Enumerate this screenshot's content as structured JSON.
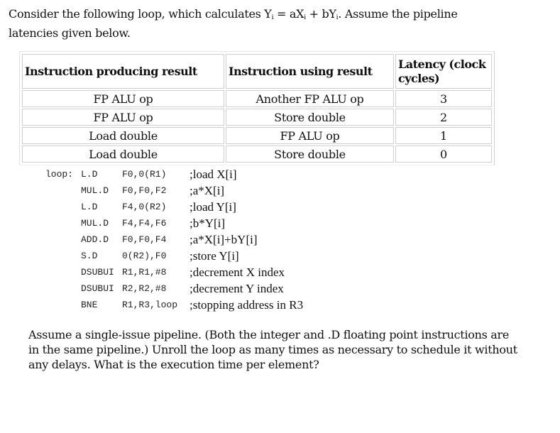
{
  "intro": {
    "part1": "Consider the following loop, which calculates Y",
    "sub1": "i",
    "part2": " = aX",
    "sub2": "i",
    "part3": " + bY",
    "sub3": "i",
    "part4": ". Assume the pipeline latencies given below."
  },
  "table": {
    "headers": [
      "Instruction producing result",
      "Instruction using result",
      "Latency (clock cycles)"
    ],
    "rows": [
      [
        "FP ALU op",
        "Another FP ALU op",
        "3"
      ],
      [
        "FP ALU op",
        "Store double",
        "2"
      ],
      [
        "Load double",
        "FP ALU op",
        "1"
      ],
      [
        "Load double",
        "Store double",
        "0"
      ]
    ]
  },
  "code": [
    {
      "label": "loop:",
      "op": "L.D",
      "args": "F0,0(R1)",
      "comment": ";load X[i]"
    },
    {
      "label": "",
      "op": "MUL.D",
      "args": "F0,F0,F2",
      "comment": ";a*X[i]"
    },
    {
      "label": "",
      "op": "L.D",
      "args": "F4,0(R2)",
      "comment": ";load Y[i]"
    },
    {
      "label": "",
      "op": "MUL.D",
      "args": "F4,F4,F6",
      "comment": ";b*Y[i]"
    },
    {
      "label": "",
      "op": "ADD.D",
      "args": "F0,F0,F4",
      "comment": ";a*X[i]+bY[i]"
    },
    {
      "label": "",
      "op": "S.D",
      "args": "0(R2),F0",
      "comment": ";store Y[i]"
    },
    {
      "label": "",
      "op": "DSUBUI",
      "args": "R1,R1,#8",
      "comment": ";decrement X index"
    },
    {
      "label": "",
      "op": "DSUBUI",
      "args": "R2,R2,#8",
      "comment": ";decrement Y index"
    },
    {
      "label": "",
      "op": "BNE",
      "args": "R1,R3,loop",
      "comment": ";stopping address in R3"
    }
  ],
  "question": "Assume a single-issue pipeline. (Both the integer and .D floating point instructions are in the same pipeline.) Unroll the loop as many times as necessary to schedule it without any delays. What is the execution time per element?"
}
